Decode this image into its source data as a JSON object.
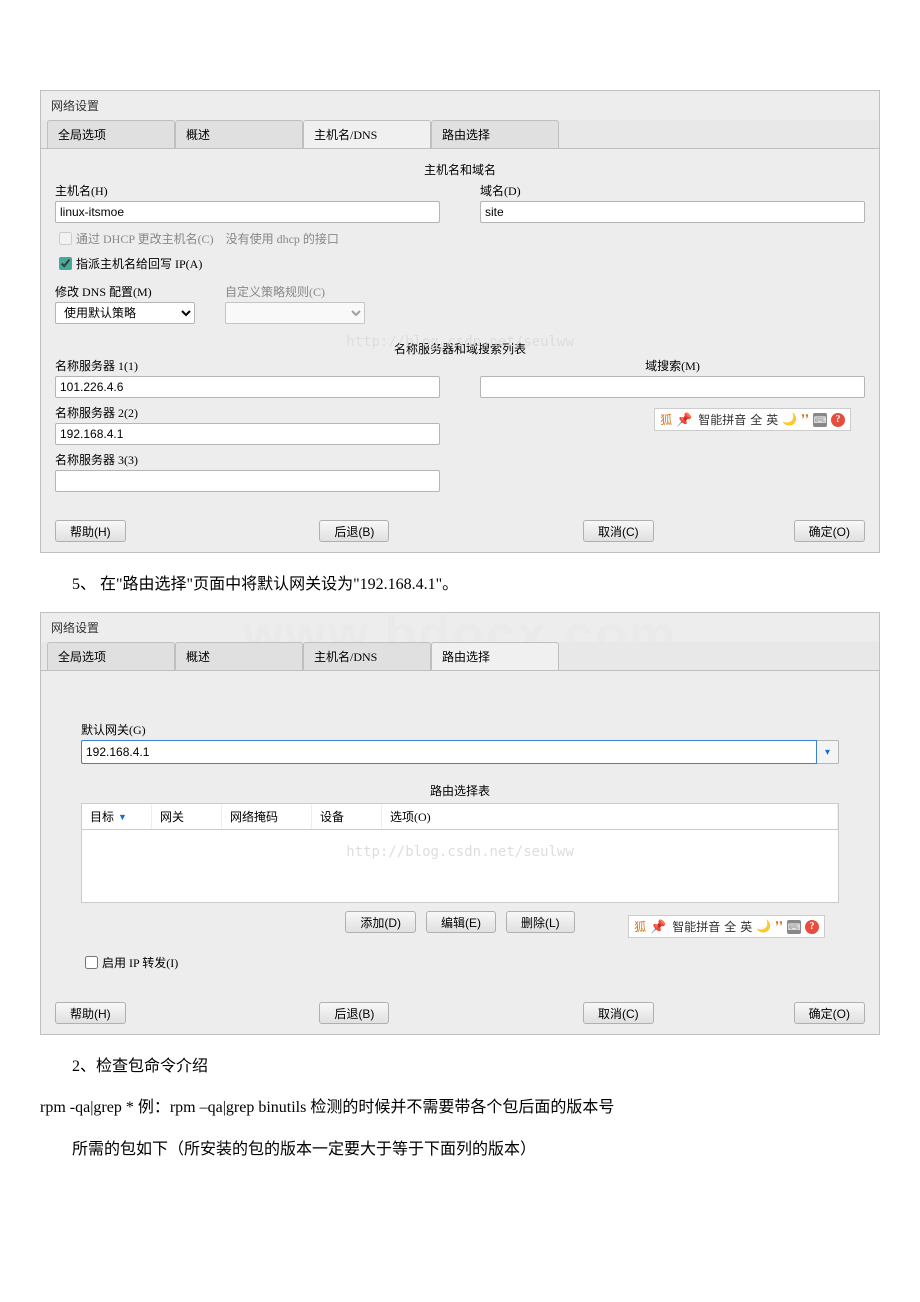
{
  "window1": {
    "title": "网络设置",
    "tabs": [
      "全局选项",
      "概述",
      "主机名/DNS",
      "路由选择"
    ],
    "hostname_section": "主机名和域名",
    "hostname_label": "主机名(H)",
    "hostname_value": "linux-itsmoe",
    "domain_label": "域名(D)",
    "domain_value": "site",
    "dhcp_hostname_label": "通过 DHCP 更改主机名(C)",
    "dhcp_hostname_note": "没有使用 dhcp 的接口",
    "assign_hostname_label": "指派主机名给回写 IP(A)",
    "dns_config_label": "修改 DNS 配置(M)",
    "dns_policy_label": "使用默认策略",
    "custom_policy_label": "自定义策略规则(C)",
    "ns_search_title": "名称服务器和域搜索列表",
    "domain_search_label": "域搜索(M)",
    "ns1_label": "名称服务器 1(1)",
    "ns1_value": "101.226.4.6",
    "ns2_label": "名称服务器 2(2)",
    "ns2_value": "192.168.4.1",
    "ns3_label": "名称服务器 3(3)"
  },
  "window2": {
    "title": "网络设置",
    "tabs": [
      "全局选项",
      "概述",
      "主机名/DNS",
      "路由选择"
    ],
    "default_gateway_label": "默认网关(G)",
    "default_gateway_value": "192.168.4.1",
    "route_table_title": "路由选择表",
    "route_cols": [
      "目标",
      "网关",
      "网络掩码",
      "设备",
      "选项(O)"
    ],
    "sort_indicator": "▼",
    "add_btn": "添加(D)",
    "edit_btn": "编辑(E)",
    "delete_btn": "删除(L)",
    "ip_forward_label": "启用 IP 转发(I)"
  },
  "buttons": {
    "help": "帮助(H)",
    "back": "后退(B)",
    "cancel": "取消(C)",
    "ok": "确定(O)"
  },
  "ime": {
    "icon": "狐",
    "pinyin": "智能拼音",
    "cn": "全",
    "en": "英"
  },
  "body_text": {
    "step5": "5、 在\"路由选择\"页面中将默认网关设为\"192.168.4.1\"。",
    "step2": "2、检查包命令介绍",
    "rpm_line": "rpm -qa|grep *  例：rpm –qa|grep binutils 检测的时候并不需要带各个包后面的版本号",
    "pkg_line": "所需的包如下（所安装的包的版本一定要大于等于下面列的版本）"
  },
  "watermarks": {
    "url": "http://blog.csdn.net/seulww",
    "big": "www.bdocx.com"
  }
}
